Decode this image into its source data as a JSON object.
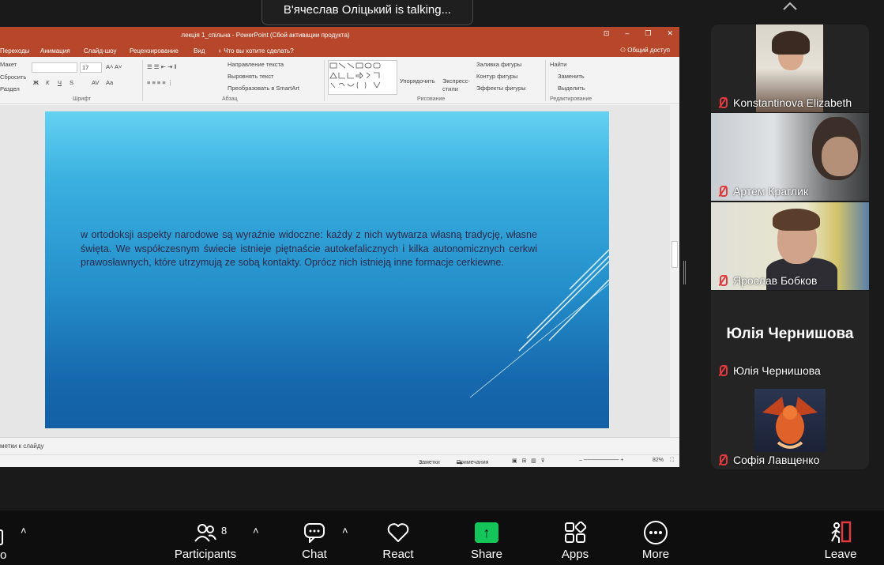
{
  "banner": {
    "talking": "В'ячеслав Оліцький is talking..."
  },
  "ppt": {
    "window_title": "лекція 1_спільна - PowerPoint (Сбой активации продукта)",
    "tabs": [
      "Переходы",
      "Анимация",
      "Слайд-шоу",
      "Рецензирование",
      "Вид"
    ],
    "tell_me": "Что вы хотите сделать?",
    "share_access": "Общий доступ",
    "ribbon": {
      "maket": "Макет",
      "reset": "Сбросить",
      "section": "Раздел",
      "font_size": "17",
      "group_font": "Шрифт",
      "group_paragraph": "Абзац",
      "group_drawing": "Рисование",
      "group_editing": "Редактирование",
      "text_direction": "Направление текста",
      "align_text": "Выровнять текст",
      "smartart": "Преобразовать в SmartArt",
      "arrange": "Упорядочить",
      "express_styles": "Экспресс-стили",
      "shape_fill": "Заливка фигуры",
      "shape_outline": "Контур фигуры",
      "shape_effects": "Эффекты фигуры",
      "find": "Найти",
      "replace": "Заменить",
      "select": "Выделить",
      "bold": "Ж",
      "italic": "К",
      "underline": "Ч",
      "strike": "S",
      "spacing": "AV",
      "case": "Aa"
    },
    "slide_text": "w ortodoksji aspekty narodowe są wyraźnie widoczne: każdy z nich wytwarza własną tradycję, własne święta. We współczesnym świecie istnieje piętnaście autokefalicznych i kilka autonomicznych cerkwi prawosławnych, które utrzymują ze sobą kontakty. Oprócz nich istnieją inne formacje cerkiewne.",
    "notes_placeholder": "метки к слайду",
    "status": {
      "notes": "Заметки",
      "comments": "Примечания",
      "zoom": "82%"
    }
  },
  "participants": [
    {
      "name": "Konstantinova Elizabeth"
    },
    {
      "name": "Артем Краглик"
    },
    {
      "name": "Ярослав Бобков"
    },
    {
      "name": "Юлія Чернишова",
      "avatar_text": "Юлія Чернишова"
    },
    {
      "name": "Софія Лавщенко"
    }
  ],
  "toolbar": {
    "participants_label": "Participants",
    "participants_count": "8",
    "chat_label": "Chat",
    "react_label": "React",
    "share_label": "Share",
    "apps_label": "Apps",
    "more_label": "More",
    "leave_label": "Leave",
    "cut_label": "o"
  },
  "colors": {
    "share_green": "#14c65a",
    "ppt_red": "#b7472a",
    "mic_red": "#e0393e"
  }
}
